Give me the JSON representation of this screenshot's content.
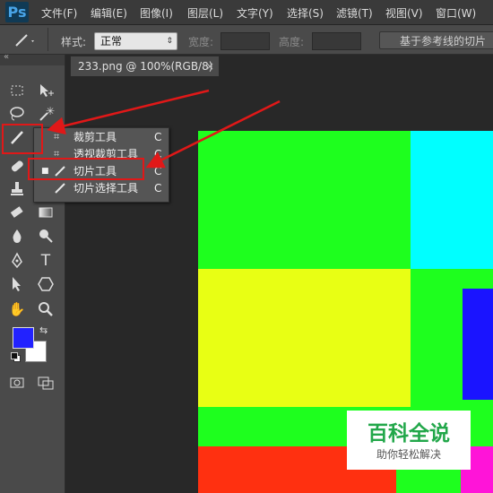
{
  "app": {
    "logo": "Ps"
  },
  "menubar": {
    "items": [
      "文件(F)",
      "编辑(E)",
      "图像(I)",
      "图层(L)",
      "文字(Y)",
      "选择(S)",
      "滤镜(T)",
      "视图(V)",
      "窗口(W)"
    ]
  },
  "options": {
    "style_label": "样式:",
    "style_value": "正常",
    "width_label": "宽度:",
    "height_label": "高度:",
    "guides_button": "基于参考线的切片"
  },
  "document_tab": {
    "title": "233.png @ 100%(RGB/8)",
    "close": "×"
  },
  "flyout": {
    "items": [
      {
        "label": "裁剪工具",
        "shortcut": "C",
        "icon": "crop-icon",
        "active": false
      },
      {
        "label": "透视裁剪工具",
        "shortcut": "C",
        "icon": "perspective-crop-icon",
        "active": false
      },
      {
        "label": "切片工具",
        "shortcut": "C",
        "icon": "slice-icon",
        "active": true
      },
      {
        "label": "切片选择工具",
        "shortcut": "C",
        "icon": "slice-select-icon",
        "active": false
      }
    ]
  },
  "colors": {
    "foreground": "#2222ff",
    "background": "#ffffff",
    "highlight": "#e01818"
  },
  "watermark": {
    "title": "百科全说",
    "subtitle": "助你轻松解决"
  }
}
